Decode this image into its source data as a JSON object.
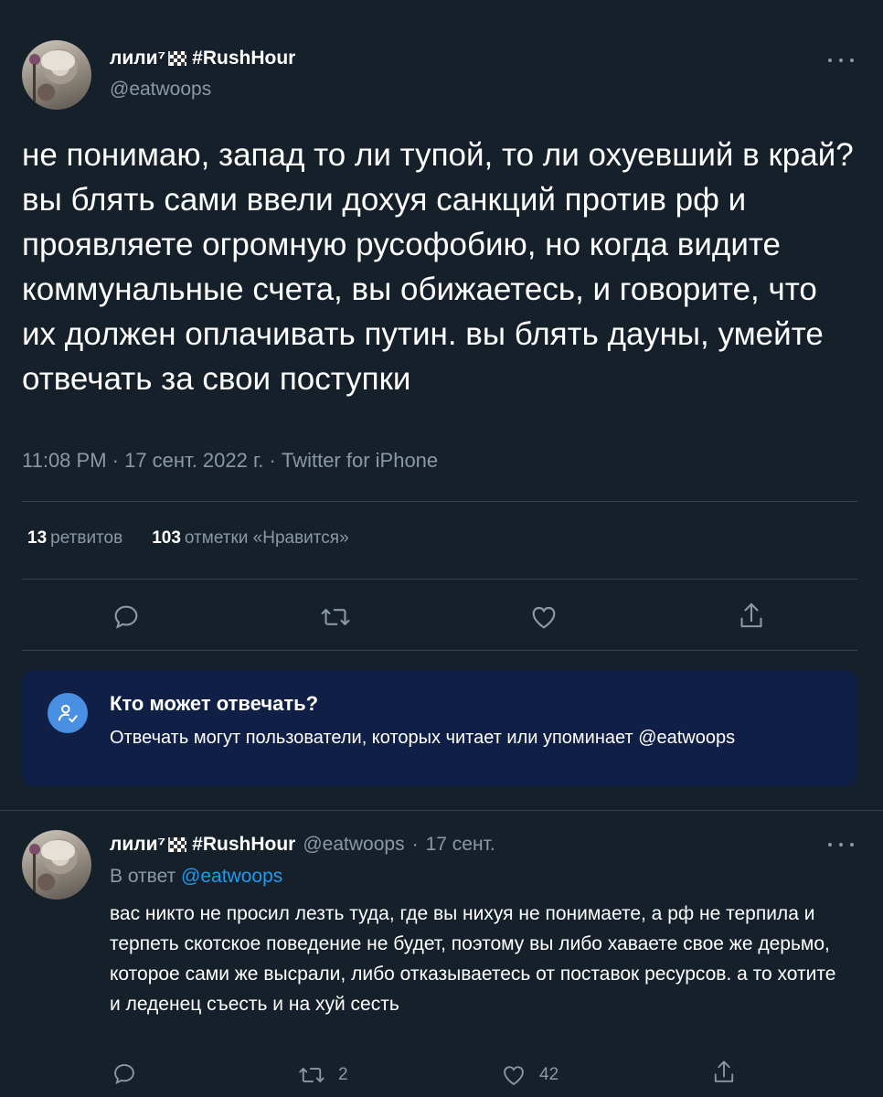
{
  "tweet": {
    "display_name": "лили⁷",
    "hashtag": "#RushHour",
    "handle": "@eatwoops",
    "text": "не понимаю, запад то ли тупой, то ли охуевший в край?\nвы блять сами ввели дохуя санкций против рф и проявляете огромную русофобию, но когда видите коммунальные счета, вы обижаетесь, и говорите, что их должен оплачивать путин. вы блять дауны, умейте отвечать за свои поступки",
    "timestamp": "11:08 PM · 17 сент. 2022 г. · Twitter for iPhone",
    "retweets_count": "13",
    "retweets_label": "ретвитов",
    "likes_count": "103",
    "likes_label": "отметки «Нравится»"
  },
  "who_can_reply": {
    "title": "Кто может отвечать?",
    "description": "Отвечать могут пользователи, которых читает или упоминает @eatwoops"
  },
  "reply": {
    "display_name": "лили⁷",
    "hashtag": "#RushHour",
    "handle": "@eatwoops",
    "separator": "·",
    "date": "17 сент.",
    "replying_to_prefix": "В ответ",
    "replying_to_mention": "@eatwoops",
    "text": "вас никто не просил лезть туда, где вы нихуя не понимаете, а рф не терпила и терпеть скотское поведение не будет, поэтому вы либо хаваете свое же дерьмо, которое сами же высрали, либо отказываетесь от поставок ресурсов. а то хотите и леденец съесть и на хуй сесть",
    "retweets": "2",
    "likes": "42"
  },
  "colors": {
    "background": "#15202b",
    "secondary_text": "#8b98a5",
    "accent": "#1d9bf0",
    "reply_box": "#0f1f45"
  }
}
